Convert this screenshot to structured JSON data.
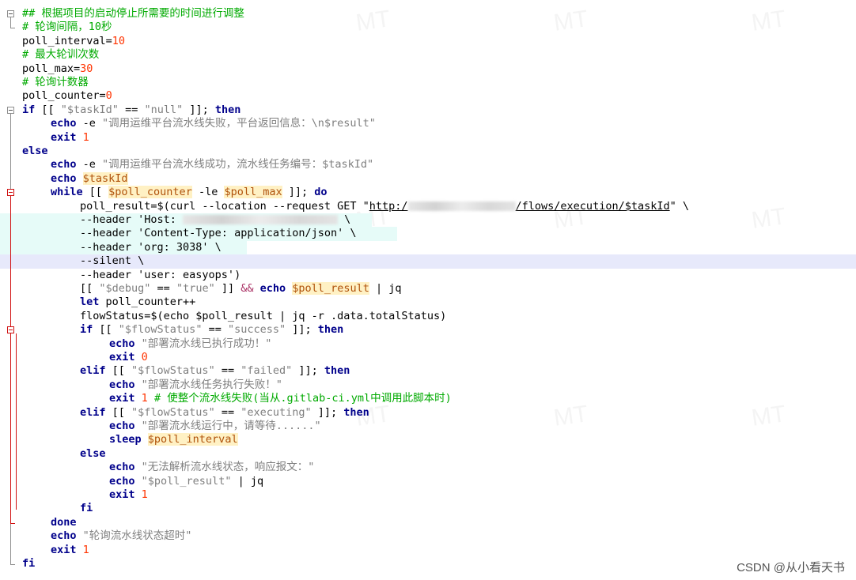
{
  "watermark": "CSDN @从小看天书",
  "code": {
    "line_01": "## 根据项目的启动停止所需要的时间进行调整",
    "line_02": "# 轮询间隔，10秒",
    "line_03_name": "poll_interval=",
    "line_03_val": "10",
    "line_04": "# 最大轮训次数",
    "line_05_name": "poll_max=",
    "line_05_val": "30",
    "line_06": "# 轮询计数器",
    "line_07_name": "poll_counter=",
    "line_07_val": "0",
    "line_08_kw": "if",
    "line_08_a": " [[ ",
    "line_08_str1": "\"$taskId\"",
    "line_08_b": " == ",
    "line_08_str2": "\"null\"",
    "line_08_c": " ]]; ",
    "line_08_then": "then",
    "line_09_kw": "echo",
    "line_09_a": " -e ",
    "line_09_str": "\"调用运维平台流水线失败，平台返回信息：\\n$result\"",
    "line_10_kw": "exit",
    "line_10_val": "1",
    "line_11_kw": "else",
    "line_12_kw": "echo",
    "line_12_a": " -e ",
    "line_12_str": "\"调用运维平台流水线成功，流水线任务编号：$taskId\"",
    "line_13_kw": "echo",
    "line_13_var": "$taskId",
    "line_14_kw": "while",
    "line_14_a": " [[ ",
    "line_14_var1": "$poll_counter",
    "line_14_b": " -le ",
    "line_14_var2": "$poll_max",
    "line_14_c": " ]]; ",
    "line_14_do": "do",
    "line_15_a": "poll_result=$(curl --location --request GET \"",
    "line_15_url1": "http:/",
    "line_15_url2": "/flows/execution/$taskId",
    "line_15_b": "\" \\",
    "line_16_a": "--header 'Host: ",
    "line_16_b": " \\",
    "line_17": "--header 'Content-Type: application/json' \\",
    "line_18": "--header 'org: 3038' \\",
    "line_19": "--silent \\",
    "line_20": "--header 'user: easyops')",
    "line_21_a": "[[ ",
    "line_21_str1": "\"$debug\"",
    "line_21_b": " == ",
    "line_21_str2": "\"true\"",
    "line_21_c": " ]] ",
    "line_21_op": "&&",
    "line_21_kw": "echo",
    "line_21_var": "$poll_result",
    "line_21_d": " | jq",
    "line_22_kw": "let",
    "line_22_a": " poll_counter++",
    "line_23": "flowStatus=$(echo $poll_result | jq -r .data.totalStatus)",
    "line_24_kw": "if",
    "line_24_a": " [[ ",
    "line_24_str1": "\"$flowStatus\"",
    "line_24_b": " == ",
    "line_24_str2": "\"success\"",
    "line_24_c": " ]]; ",
    "line_24_then": "then",
    "line_25_kw": "echo",
    "line_25_str": "\"部署流水线已执行成功！\"",
    "line_26_kw": "exit",
    "line_26_val": "0",
    "line_27_kw": "elif",
    "line_27_a": " [[ ",
    "line_27_str1": "\"$flowStatus\"",
    "line_27_b": " == ",
    "line_27_str2": "\"failed\"",
    "line_27_c": " ]]; ",
    "line_27_then": "then",
    "line_28_kw": "echo",
    "line_28_str": "\"部署流水线任务执行失败！\"",
    "line_29_kw": "exit",
    "line_29_val": "1",
    "line_29_cmt": "# 使整个流水线失败(当从.gitlab-ci.yml中调用此脚本时)",
    "line_30_kw": "elif",
    "line_30_a": " [[ ",
    "line_30_str1": "\"$flowStatus\"",
    "line_30_b": " == ",
    "line_30_str2": "\"executing\"",
    "line_30_c": " ]]; ",
    "line_30_then": "then",
    "line_31_kw": "echo",
    "line_31_str": "\"部署流水线运行中，请等待......\"",
    "line_32_kw": "sleep",
    "line_32_var": "$poll_interval",
    "line_33_kw": "else",
    "line_34_kw": "echo",
    "line_34_str": "\"无法解析流水线状态，响应报文：\"",
    "line_35_kw": "echo",
    "line_35_str": "\"$poll_result\"",
    "line_35_a": " | jq",
    "line_36_kw": "exit",
    "line_36_val": "1",
    "line_37_kw": "fi",
    "line_38_kw": "done",
    "line_39_kw": "echo",
    "line_39_str": "\"轮询流水线状态超时\"",
    "line_40_kw": "exit",
    "line_40_val": "1",
    "line_41_kw": "fi"
  },
  "colors": {
    "keyword": "#00008b",
    "string": "#7f7f7f",
    "number": "#ff3300",
    "comment": "#00aa00",
    "variable": "#b0520b",
    "variable_bg": "#fff1c4",
    "highlight_cyan": "#e6fbf8",
    "highlight_lavender": "#e7e9fb",
    "fold_marker_red": "#d01010"
  }
}
